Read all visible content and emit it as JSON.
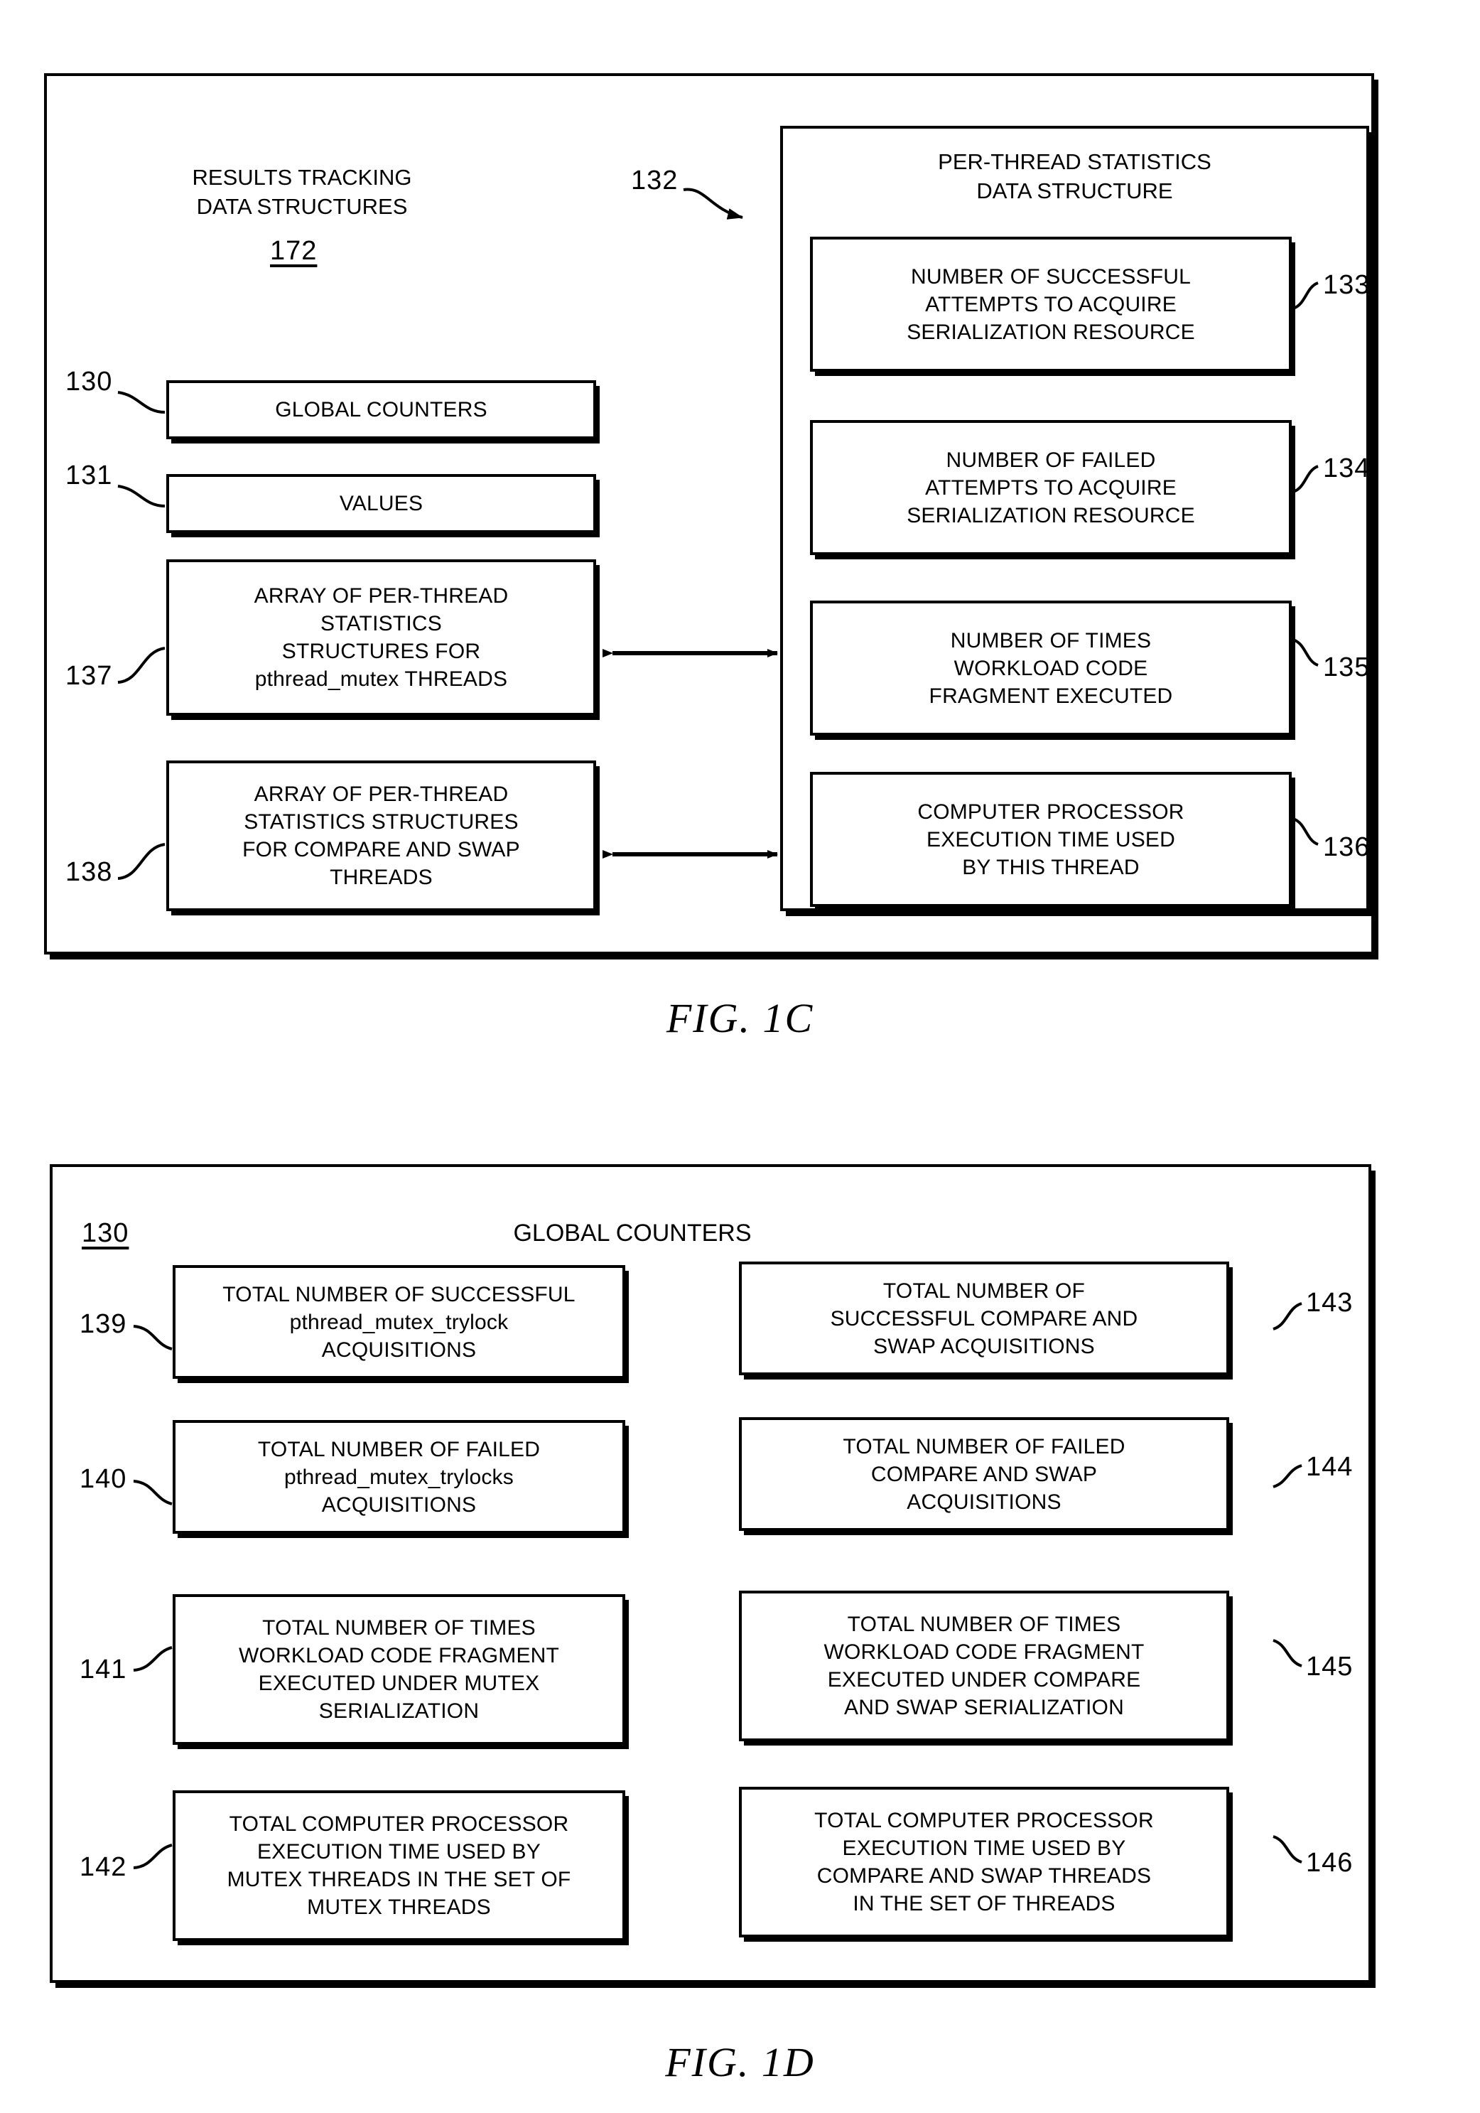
{
  "figures": [
    {
      "caption": "FIG. 1C",
      "left_panel": {
        "title": "RESULTS TRACKING\nDATA STRUCTURES",
        "title_ref": "172",
        "boxes": [
          {
            "ref": "130",
            "label": "GLOBAL COUNTERS"
          },
          {
            "ref": "131",
            "label": "VALUES"
          },
          {
            "ref": "137",
            "label": "ARRAY OF PER-THREAD\nSTATISTICS\nSTRUCTURES FOR\npthread_mutex THREADS"
          },
          {
            "ref": "138",
            "label": "ARRAY OF PER-THREAD\nSTATISTICS STRUCTURES\nFOR COMPARE AND SWAP\nTHREADS"
          }
        ]
      },
      "right_panel": {
        "ref": "132",
        "title": "PER-THREAD STATISTICS\nDATA STRUCTURE",
        "boxes": [
          {
            "ref": "133",
            "label": "NUMBER OF SUCCESSFUL\nATTEMPTS TO ACQUIRE\nSERIALIZATION RESOURCE"
          },
          {
            "ref": "134",
            "label": "NUMBER OF FAILED\nATTEMPTS TO ACQUIRE\nSERIALIZATION RESOURCE"
          },
          {
            "ref": "135",
            "label": "NUMBER OF TIMES\nWORKLOAD CODE\nFRAGMENT EXECUTED"
          },
          {
            "ref": "136",
            "label": "COMPUTER PROCESSOR\nEXECUTION TIME USED\nBY THIS THREAD"
          }
        ]
      }
    },
    {
      "caption": "FIG. 1D",
      "panel_ref": "130",
      "panel_title": "GLOBAL COUNTERS",
      "left_boxes": [
        {
          "ref": "139",
          "label": "TOTAL NUMBER OF SUCCESSFUL\npthread_mutex_trylock\nACQUISITIONS"
        },
        {
          "ref": "140",
          "label": "TOTAL NUMBER OF FAILED\npthread_mutex_trylocks\nACQUISITIONS"
        },
        {
          "ref": "141",
          "label": "TOTAL NUMBER OF TIMES\nWORKLOAD CODE FRAGMENT\nEXECUTED UNDER MUTEX\nSERIALIZATION"
        },
        {
          "ref": "142",
          "label": "TOTAL COMPUTER PROCESSOR\nEXECUTION TIME USED BY\nMUTEX THREADS IN THE SET OF\nMUTEX THREADS"
        }
      ],
      "right_boxes": [
        {
          "ref": "143",
          "label": "TOTAL NUMBER OF\nSUCCESSFUL COMPARE AND\nSWAP ACQUISITIONS"
        },
        {
          "ref": "144",
          "label": "TOTAL NUMBER OF FAILED\nCOMPARE AND SWAP\nACQUISITIONS"
        },
        {
          "ref": "145",
          "label": "TOTAL NUMBER OF TIMES\nWORKLOAD CODE FRAGMENT\nEXECUTED UNDER COMPARE\nAND SWAP SERIALIZATION"
        },
        {
          "ref": "146",
          "label": "TOTAL COMPUTER PROCESSOR\nEXECUTION TIME USED BY\nCOMPARE AND SWAP THREADS\nIN THE SET OF THREADS"
        }
      ]
    }
  ],
  "colors": {
    "ink": "#000000",
    "paper": "#ffffff"
  }
}
